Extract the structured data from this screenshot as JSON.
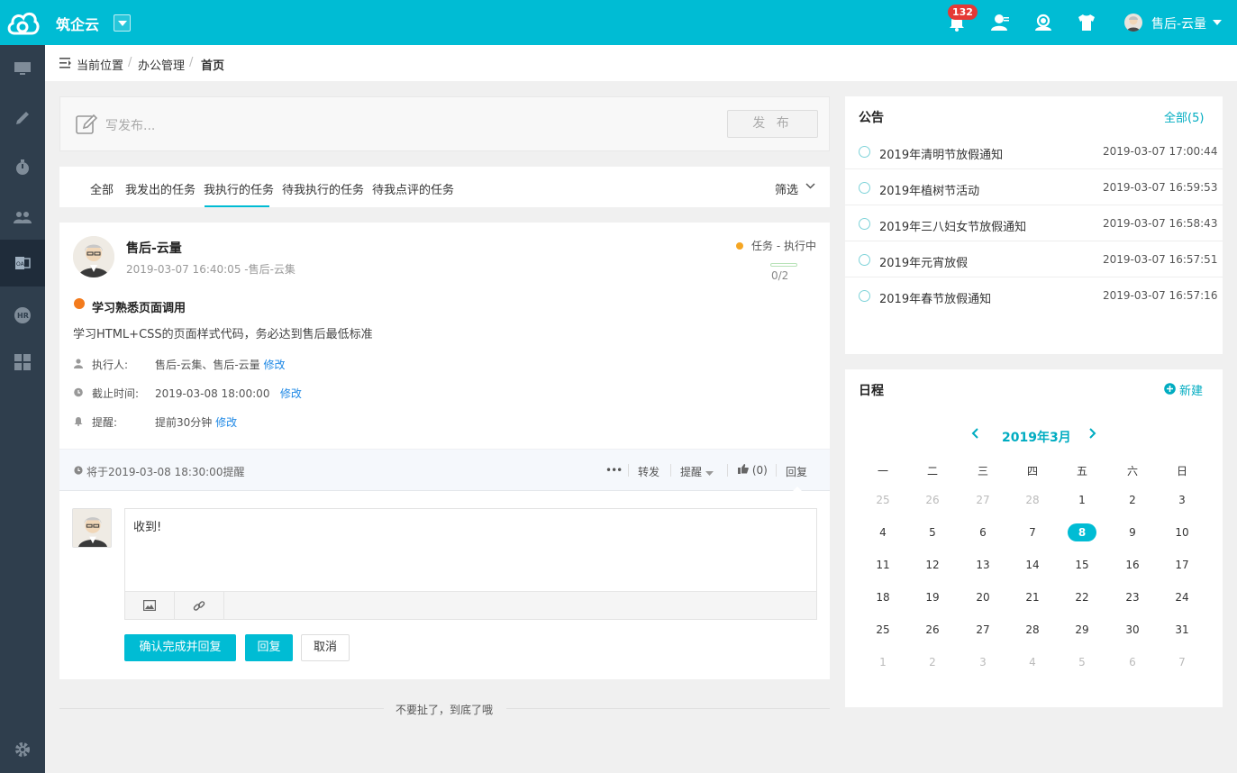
{
  "brand": {
    "name": "筑企云"
  },
  "topbar": {
    "notifications": "132",
    "user_name": "售后-云量"
  },
  "breadcrumb": {
    "label": "当前位置",
    "items": [
      "办公管理",
      "首页"
    ]
  },
  "compose": {
    "placeholder": "写发布...",
    "publish_label": "发 布"
  },
  "tabs": {
    "items": [
      "全部",
      "我发出的任务",
      "我执行的任务",
      "待我执行的任务",
      "待我点评的任务"
    ],
    "active": "我执行的任务",
    "filter_label": "筛选"
  },
  "task": {
    "author": "售后-云量",
    "time": "2019-03-07 16:40:05 -售后-云集",
    "status": "任务 - 执行中",
    "progress": "0/2",
    "progress_fraction": 0,
    "title": "学习熟悉页面调用",
    "description": "学习HTML+CSS的页面样式代码，务必达到售后最低标准",
    "executor_label": "执行人:",
    "executor_value": "售后-云集、售后-云量",
    "deadline_label": "截止时间:",
    "deadline_value": "2019-03-08 18:00:00",
    "reminder_label": "提醒:",
    "reminder_value": "提前30分钟",
    "edit_label": "修改",
    "remind_note": "将于2019-03-08 18:30:00提醒",
    "actions": {
      "more": "•••",
      "forward": "转发",
      "remind": "提醒",
      "like": "(0)",
      "reply": "回复"
    }
  },
  "reply": {
    "text": "收到!",
    "confirm_label": "确认完成并回复",
    "reply_label": "回复",
    "cancel_label": "取消"
  },
  "end_text": "不要扯了，到底了哦",
  "notices": {
    "title": "公告",
    "more": "全部(5)",
    "items": [
      {
        "title": "2019年清明节放假通知",
        "time": "2019-03-07 17:00:44"
      },
      {
        "title": "2019年植树节活动",
        "time": "2019-03-07 16:59:53"
      },
      {
        "title": "2019年三八妇女节放假通知",
        "time": "2019-03-07 16:58:43"
      },
      {
        "title": "2019年元宵放假",
        "time": "2019-03-07 16:57:51"
      },
      {
        "title": "2019年春节放假通知",
        "time": "2019-03-07 16:57:16"
      }
    ]
  },
  "schedule": {
    "title": "日程",
    "new_label": "新建",
    "month": "2019年3月",
    "weekdays": [
      "一",
      "二",
      "三",
      "四",
      "五",
      "六",
      "日"
    ],
    "weeks": [
      [
        "25",
        "26",
        "27",
        "28",
        "1",
        "2",
        "3"
      ],
      [
        "4",
        "5",
        "6",
        "7",
        "8",
        "9",
        "10"
      ],
      [
        "11",
        "12",
        "13",
        "14",
        "15",
        "16",
        "17"
      ],
      [
        "18",
        "19",
        "20",
        "21",
        "22",
        "23",
        "24"
      ],
      [
        "25",
        "26",
        "27",
        "28",
        "29",
        "30",
        "31"
      ],
      [
        "1",
        "2",
        "3",
        "4",
        "5",
        "6",
        "7"
      ]
    ],
    "today": "8"
  },
  "colors": {
    "accent": "#00bcd4",
    "sidebar": "#2f3e4d",
    "link": "#1e88e5",
    "status_dot": "#f5a623"
  }
}
